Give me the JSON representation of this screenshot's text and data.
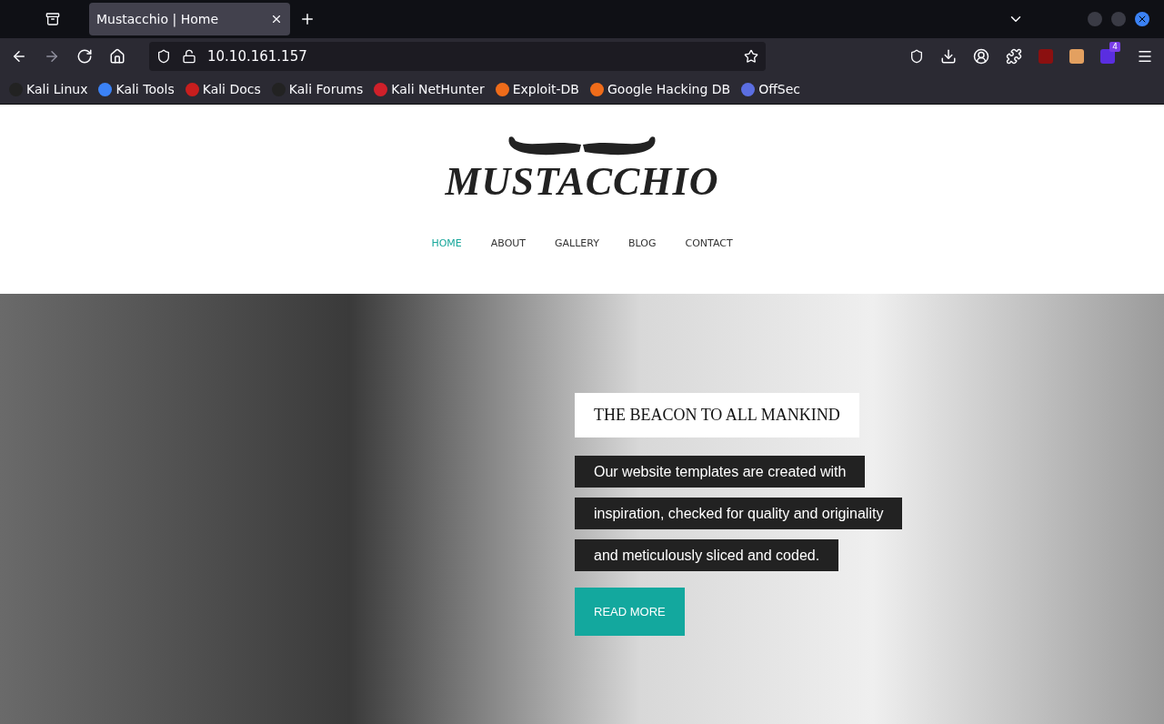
{
  "browser": {
    "tabs": [
      {
        "title": "Mustacchio | Home",
        "selected": true
      }
    ],
    "address": "10.10.161.157",
    "extension_badge": "4",
    "bookmarks": [
      {
        "label": "Kali Linux",
        "color": "#222222"
      },
      {
        "label": "Kali Tools",
        "color": "#3b82f6"
      },
      {
        "label": "Kali Docs",
        "color": "#c81e1e"
      },
      {
        "label": "Kali Forums",
        "color": "#222222"
      },
      {
        "label": "Kali NetHunter",
        "color": "#d0202a"
      },
      {
        "label": "Exploit-DB",
        "color": "#ef6c1a"
      },
      {
        "label": "Google Hacking DB",
        "color": "#ef6c1a"
      },
      {
        "label": "OffSec",
        "color": "#5b6ee1"
      }
    ]
  },
  "site": {
    "logo": "MUSTACCHIO",
    "nav": [
      {
        "label": "HOME",
        "selected": true
      },
      {
        "label": "ABOUT",
        "selected": false
      },
      {
        "label": "GALLERY",
        "selected": false
      },
      {
        "label": "BLOG",
        "selected": false
      },
      {
        "label": "CONTACT",
        "selected": false
      }
    ],
    "hero": {
      "title": "THE BEACON TO ALL MANKIND",
      "lines": [
        "Our website templates are created with",
        "inspiration, checked for quality and originality",
        "and meticulously sliced and coded."
      ],
      "button": "READ MORE"
    }
  }
}
